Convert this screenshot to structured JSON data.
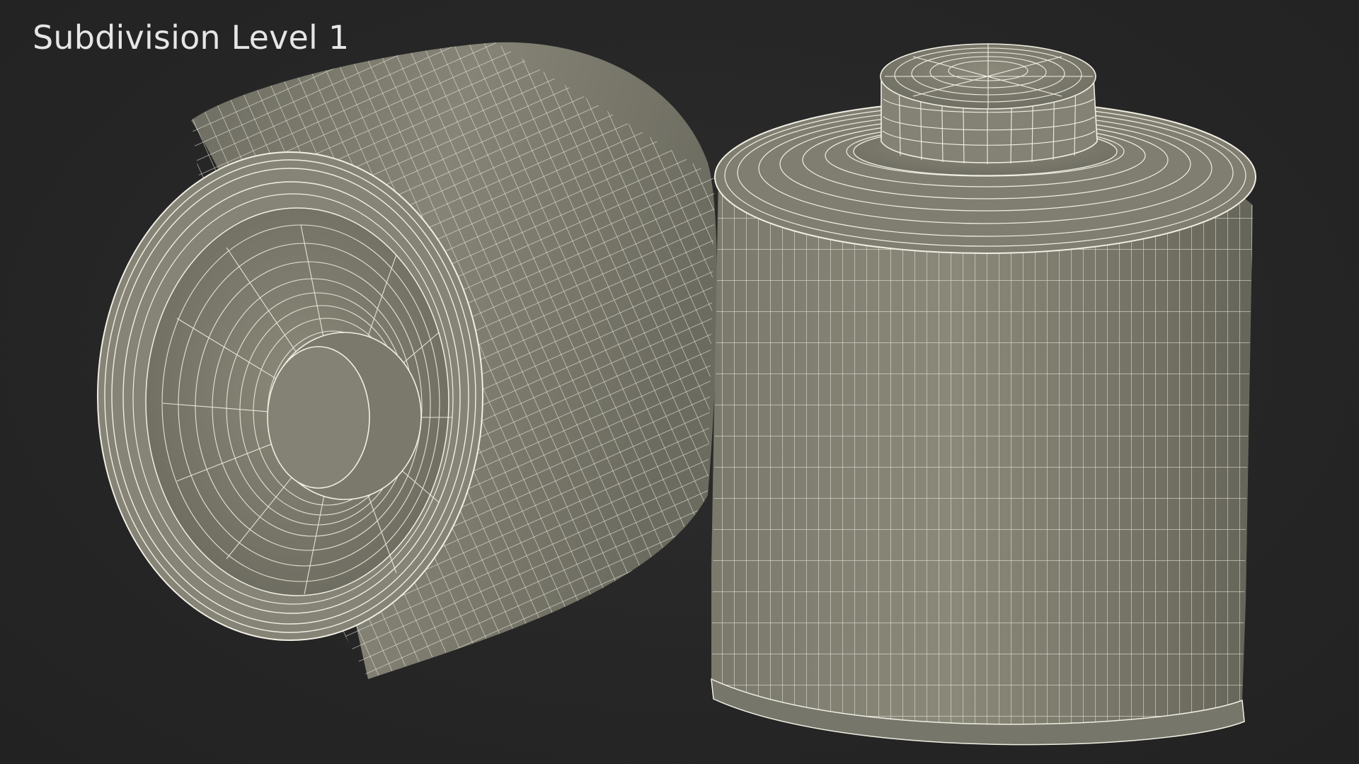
{
  "viewport": {
    "caption": "Subdivision Level 1",
    "background_color": "#262626",
    "caption_color": "#e6e6e6"
  },
  "models": [
    {
      "name": "can-lying-on-side",
      "surface_color": "#7d7c6e",
      "wire_color": "#f1efe4"
    },
    {
      "name": "can-upright-with-spout",
      "surface_color": "#7d7c6e",
      "wire_color": "#f1efe4"
    }
  ]
}
